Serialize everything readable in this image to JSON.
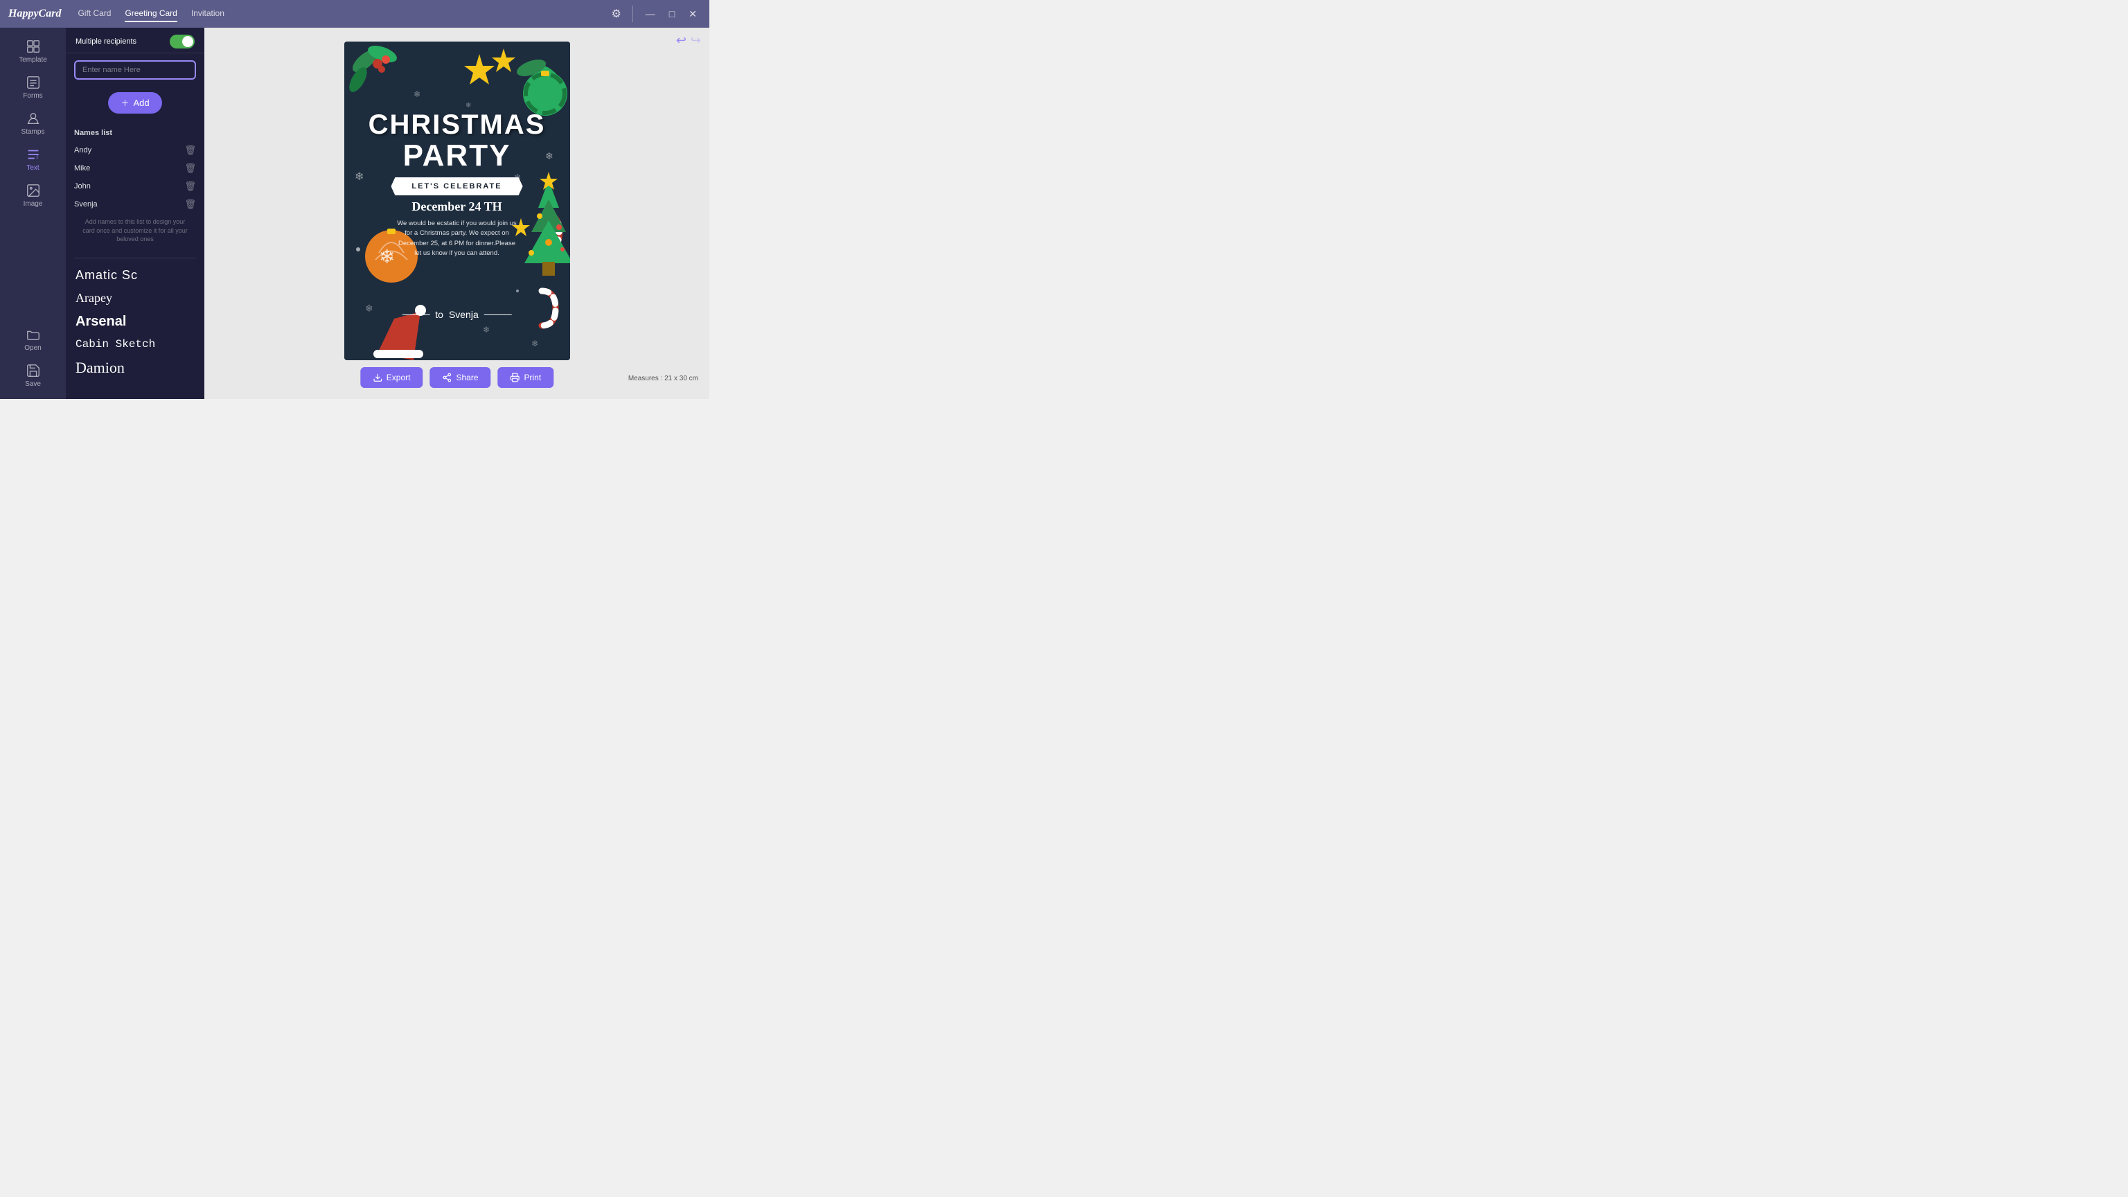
{
  "app": {
    "logo": "HappyCard",
    "nav": [
      {
        "label": "Gift Card",
        "active": false
      },
      {
        "label": "Greeting Card",
        "active": true
      },
      {
        "label": "Invitation",
        "active": false
      }
    ]
  },
  "topbar": {
    "settings_icon": "⚙",
    "minimize_icon": "—",
    "maximize_icon": "□",
    "close_icon": "✕",
    "undo_icon": "↩",
    "redo_icon": "↪"
  },
  "sidebar": {
    "items": [
      {
        "id": "template",
        "label": "Template",
        "active": false
      },
      {
        "id": "forms",
        "label": "Forms",
        "active": false
      },
      {
        "id": "stamps",
        "label": "Stamps",
        "active": false
      },
      {
        "id": "text",
        "label": "Text",
        "active": true
      },
      {
        "id": "image",
        "label": "Image",
        "active": false
      },
      {
        "id": "open",
        "label": "Open",
        "active": false
      },
      {
        "id": "save",
        "label": "Save",
        "active": false
      }
    ]
  },
  "panel": {
    "multiple_recipients_label": "Multiple recipients",
    "toggle_on": true,
    "name_input_placeholder": "Enter name Here",
    "add_button_label": "+ Add",
    "names_list_title": "Names list",
    "names": [
      {
        "name": "Andy"
      },
      {
        "name": "Mike"
      },
      {
        "name": "John"
      },
      {
        "name": "Svenja"
      }
    ],
    "names_hint": "Add names to this list to design your card once and customize it for all your beloved ones",
    "fonts": [
      {
        "label": "Amatic Sc",
        "class": "font-amatic"
      },
      {
        "label": "Arapey",
        "class": "font-arapey"
      },
      {
        "label": "Arsenal",
        "class": "font-arsenal"
      },
      {
        "label": "Cabin Sketch",
        "class": "font-cabin"
      },
      {
        "label": "Damion",
        "class": "font-damion"
      }
    ]
  },
  "card": {
    "title_christmas": "CHRISTMAS",
    "title_party": "PARTY",
    "banner_text": "LET'S CELEBRATE",
    "date_text": "December 24 TH",
    "body_text": "We would be ecstatic if you would join us for a Christmas party. We expect on December 25, at 6 PM for dinner.Please let us know if you can attend.",
    "to_label": "to",
    "to_name": "Svenja"
  },
  "toolbar": {
    "export_label": "Export",
    "share_label": "Share",
    "print_label": "Print"
  },
  "measures": {
    "label": "Measures :",
    "value": "21 x 30 cm"
  }
}
